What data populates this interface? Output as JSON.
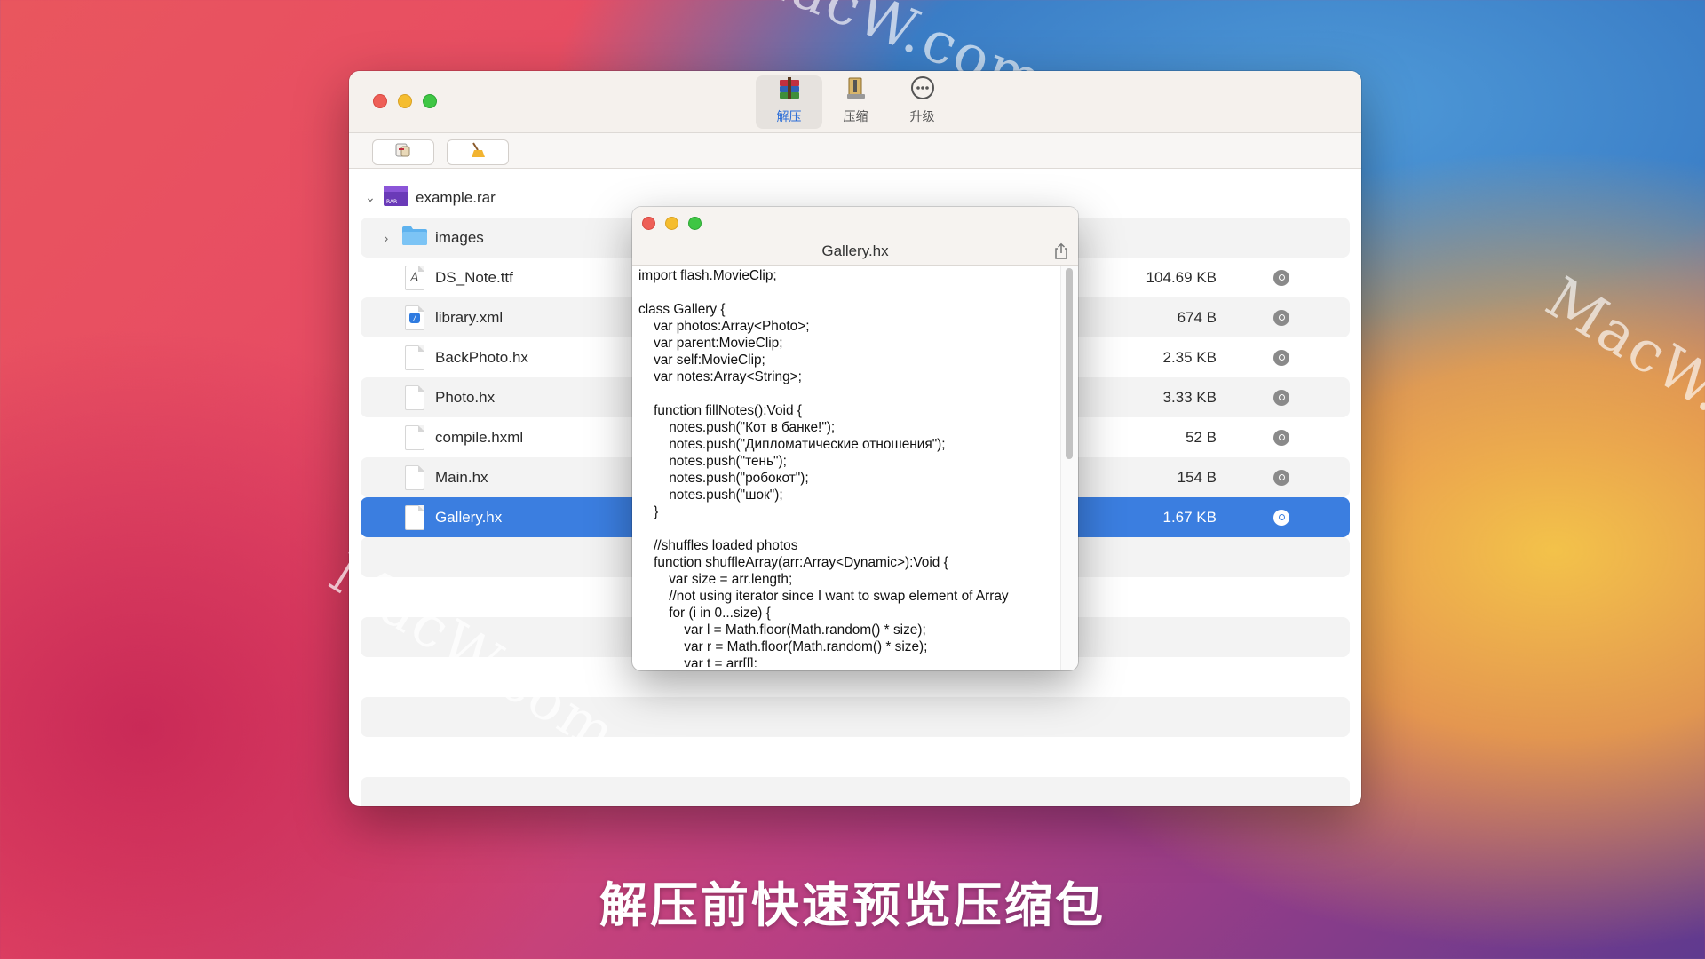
{
  "watermark": "MacW.com",
  "toolbar": {
    "items": [
      {
        "label": "解压",
        "icon": "rar-archive-icon",
        "active": true
      },
      {
        "label": "压缩",
        "icon": "compress-icon",
        "active": false
      },
      {
        "label": "升级",
        "icon": "more-icon",
        "active": false
      }
    ],
    "sub_buttons": [
      {
        "icon": "extract-hand-icon"
      },
      {
        "icon": "broom-icon"
      }
    ]
  },
  "archive": {
    "name": "example.rar",
    "items": [
      {
        "name": "images",
        "type": "folder",
        "size": ""
      },
      {
        "name": "DS_Note.ttf",
        "type": "font",
        "size": "104.69 KB"
      },
      {
        "name": "library.xml",
        "type": "xml",
        "size": "674 B"
      },
      {
        "name": "BackPhoto.hx",
        "type": "file",
        "size": "2.35 KB"
      },
      {
        "name": "Photo.hx",
        "type": "file",
        "size": "3.33 KB"
      },
      {
        "name": "compile.hxml",
        "type": "file",
        "size": "52 B"
      },
      {
        "name": "Main.hx",
        "type": "file",
        "size": "154 B"
      },
      {
        "name": "Gallery.hx",
        "type": "file",
        "size": "1.67 KB",
        "selected": true
      }
    ]
  },
  "preview": {
    "title": "Gallery.hx",
    "code": [
      "import flash.MovieClip;",
      "",
      "class Gallery {",
      "    var photos:Array<Photo>;",
      "    var parent:MovieClip;",
      "    var self:MovieClip;",
      "    var notes:Array<String>;",
      "",
      "    function fillNotes():Void {",
      "        notes.push(\"Кот в банке!\");",
      "        notes.push(\"Дипломатические отношения\");",
      "        notes.push(\"тень\");",
      "        notes.push(\"робокот\");",
      "        notes.push(\"шок\");",
      "    }",
      "",
      "    //shuffles loaded photos",
      "    function shuffleArray(arr:Array<Dynamic>):Void {",
      "        var size = arr.length;",
      "        //not using iterator since I want to swap element of Array",
      "        for (i in 0...size) {",
      "            var l = Math.floor(Math.random() * size);",
      "            var r = Math.floor(Math.random() * size);",
      "            var t = arr[l];"
    ]
  },
  "caption": "解压前快速预览压缩包"
}
